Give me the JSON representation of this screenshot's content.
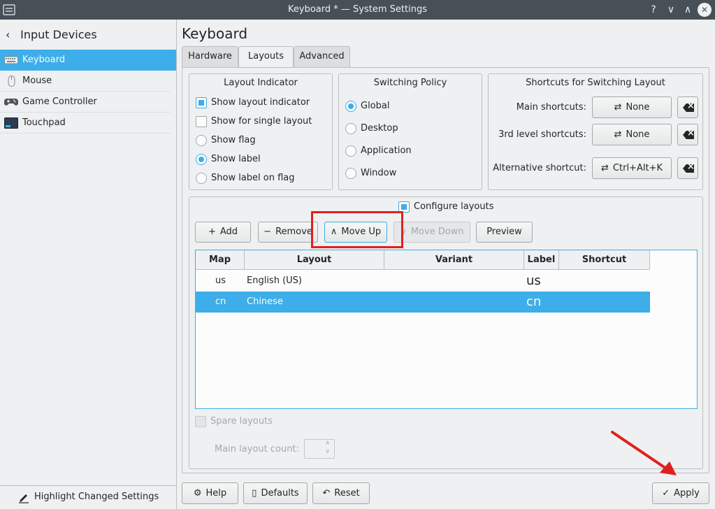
{
  "window": {
    "title": "Keyboard * — System Settings",
    "buttons": {
      "help": "?",
      "minimize": "∨",
      "maximize": "∧",
      "close": "✕"
    }
  },
  "sidebar": {
    "header": "Input Devices",
    "back_icon": "chevron-left-icon",
    "items": [
      {
        "label": "Keyboard",
        "icon": "keyboard-icon",
        "selected": true
      },
      {
        "label": "Mouse",
        "icon": "mouse-icon",
        "selected": false
      },
      {
        "label": "Game Controller",
        "icon": "gamepad-icon",
        "selected": false
      },
      {
        "label": "Touchpad",
        "icon": "touchpad-icon",
        "selected": false
      }
    ],
    "footer_button": "Highlight Changed Settings"
  },
  "page": {
    "title": "Keyboard",
    "tabs": [
      {
        "label": "Hardware",
        "active": false
      },
      {
        "label": "Layouts",
        "active": true
      },
      {
        "label": "Advanced",
        "active": false
      }
    ]
  },
  "layout_indicator": {
    "title": "Layout Indicator",
    "options": [
      {
        "label": "Show layout indicator",
        "type": "checkbox",
        "checked": true
      },
      {
        "label": "Show for single layout",
        "type": "checkbox",
        "checked": false
      },
      {
        "label": "Show flag",
        "type": "radio",
        "checked": false
      },
      {
        "label": "Show label",
        "type": "radio",
        "checked": true
      },
      {
        "label": "Show label on flag",
        "type": "radio",
        "checked": false
      }
    ]
  },
  "switching_policy": {
    "title": "Switching Policy",
    "options": [
      {
        "label": "Global",
        "checked": true
      },
      {
        "label": "Desktop",
        "checked": false
      },
      {
        "label": "Application",
        "checked": false
      },
      {
        "label": "Window",
        "checked": false
      }
    ]
  },
  "shortcuts": {
    "title": "Shortcuts for Switching Layout",
    "rows": [
      {
        "label": "Main shortcuts:",
        "value": "None"
      },
      {
        "label": "3rd level shortcuts:",
        "value": "None"
      },
      {
        "label": "Alternative shortcut:",
        "value": "Ctrl+Alt+K"
      }
    ]
  },
  "configure": {
    "checkbox_label": "Configure layouts",
    "checked": true,
    "buttons": {
      "add": "Add",
      "remove": "Remove",
      "move_up": "Move Up",
      "move_down": "Move Down",
      "preview": "Preview"
    },
    "table": {
      "columns": [
        "Map",
        "Layout",
        "Variant",
        "Label",
        "Shortcut"
      ],
      "rows": [
        {
          "map": "us",
          "layout": "English (US)",
          "variant": "",
          "label": "us",
          "shortcut": "",
          "selected": false
        },
        {
          "map": "cn",
          "layout": "Chinese",
          "variant": "",
          "label": "cn",
          "shortcut": "",
          "selected": true
        }
      ]
    },
    "spare_layouts": "Spare layouts",
    "main_layout_count": "Main layout count:"
  },
  "footer": {
    "help": "Help",
    "defaults": "Defaults",
    "reset": "Reset",
    "apply": "Apply"
  },
  "annotation_color": "#e02020",
  "accent_color": "#3daee9"
}
